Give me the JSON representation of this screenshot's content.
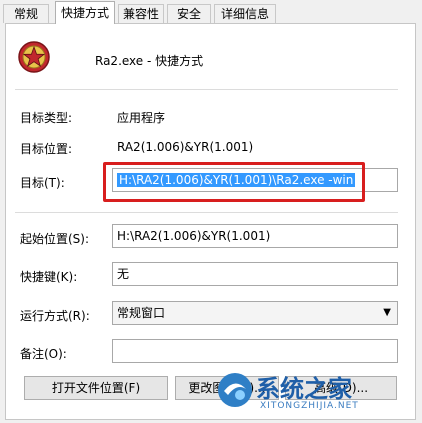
{
  "tabs": [
    {
      "label": "常规",
      "active": false
    },
    {
      "label": "快捷方式",
      "active": true
    },
    {
      "label": "兼容性",
      "active": false
    },
    {
      "label": "安全",
      "active": false
    },
    {
      "label": "详细信息",
      "active": false
    }
  ],
  "header": {
    "icon": "red-star-app-icon",
    "title": "Ra2.exe - 快捷方式"
  },
  "properties": {
    "target_type_label": "目标类型:",
    "target_type_value": "应用程序",
    "target_location_label": "目标位置:",
    "target_location_value": "RA2(1.006)&YR(1.001)",
    "target_label": "目标(T):",
    "target_value": "H:\\RA2(1.006)&YR(1.001)\\Ra2.exe -win",
    "start_in_label": "起始位置(S):",
    "start_in_value": "H:\\RA2(1.006)&YR(1.001)",
    "shortcut_key_label": "快捷键(K):",
    "shortcut_key_value": "无",
    "run_label": "运行方式(R):",
    "run_value": "常规窗口",
    "comment_label": "备注(O):",
    "comment_value": ""
  },
  "buttons": {
    "open_location": "打开文件位置(F)",
    "change_icon": "更改图标(C)...",
    "advanced": "高级(D)..."
  },
  "watermark": {
    "brand": "系统之家",
    "url": "XITONGZHIJIA.NET"
  },
  "colors": {
    "highlight": "#3399ff",
    "annotation_red": "#d81e1e"
  }
}
